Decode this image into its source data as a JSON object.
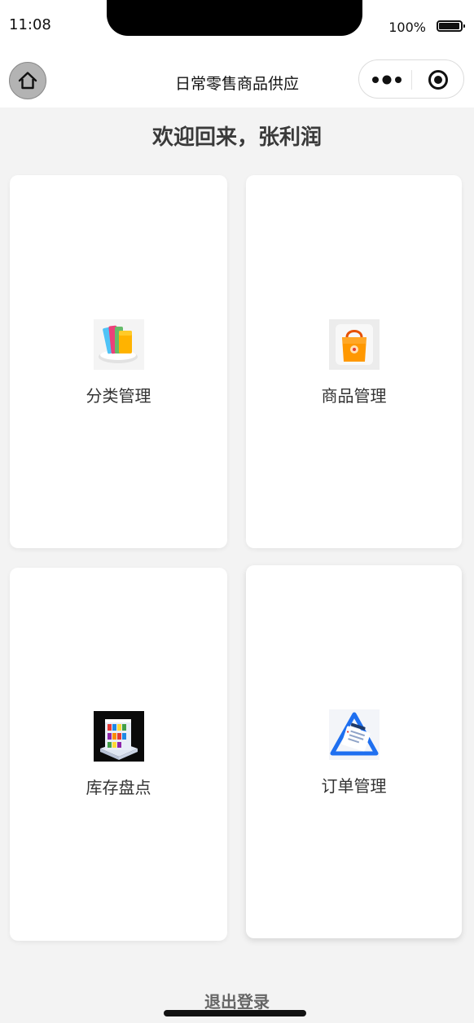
{
  "status_bar": {
    "time": "11:08",
    "battery": "100%"
  },
  "nav": {
    "title": "日常零售商品供应",
    "home_icon": "home-icon",
    "menu_icon": "more-dots-icon",
    "close_icon": "target-close-icon"
  },
  "welcome": "欢迎回来，张利润",
  "cards": [
    {
      "label": "分类管理",
      "icon": "folders-icon"
    },
    {
      "label": "商品管理",
      "icon": "shopping-bag-icon"
    },
    {
      "label": "库存盘点",
      "icon": "shelf-icon"
    },
    {
      "label": "订单管理",
      "icon": "order-sheet-icon"
    }
  ],
  "logout": "退出登录"
}
